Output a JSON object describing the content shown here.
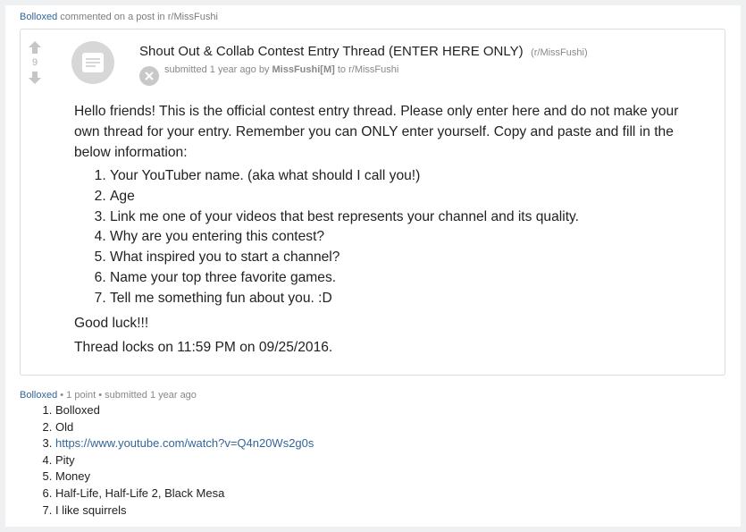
{
  "header": {
    "user": "Bolloxed",
    "action_text": "commented on a post in",
    "subreddit": "r/MissFushi"
  },
  "post": {
    "score": "9",
    "title": "Shout Out & Collab Contest Entry Thread (ENTER HERE ONLY)",
    "title_sub": "(r/MissFushi)",
    "tagline": {
      "submitted": "submitted",
      "time": "1 year ago",
      "by": "by",
      "author": "MissFushi",
      "mod_tag": "[M]",
      "to": "to",
      "subreddit": "r/MissFushi"
    },
    "body": {
      "intro": "Hello friends! This is the official contest entry thread. Please only enter here and do not make your own thread for your entry. Remember you can ONLY enter yourself. Copy and paste and fill in the below information:",
      "items": [
        "Your YouTuber name. (aka what should I call you!)",
        "Age",
        "Link me one of your videos that best represents your channel and its quality.",
        "Why are you entering this contest?",
        "What inspired you to start a channel?",
        "Name your top three favorite games.",
        "Tell me something fun about you. :D"
      ],
      "good_luck": "Good luck!!!",
      "locks": "Thread locks on 11:59 PM on 09/25/2016."
    },
    "icons": {
      "upvote": "upvote-arrow-icon",
      "downvote": "downvote-arrow-icon",
      "thumbnail": "text-post-icon",
      "expando": "close-icon"
    }
  },
  "comment": {
    "author": "Bolloxed",
    "sep1": " • ",
    "points": "1 point",
    "sep2": " • ",
    "submitted": "submitted",
    "time": "1 year ago",
    "items": [
      "Bolloxed",
      "Old",
      "https://www.youtube.com/watch?v=Q4n20Ws2g0s",
      "Pity",
      "Money",
      "Half-Life, Half-Life 2, Black Mesa",
      "I like squirrels"
    ]
  },
  "colors": {
    "link": "#336699",
    "meta": "#888888",
    "background": "#eef0f2"
  }
}
